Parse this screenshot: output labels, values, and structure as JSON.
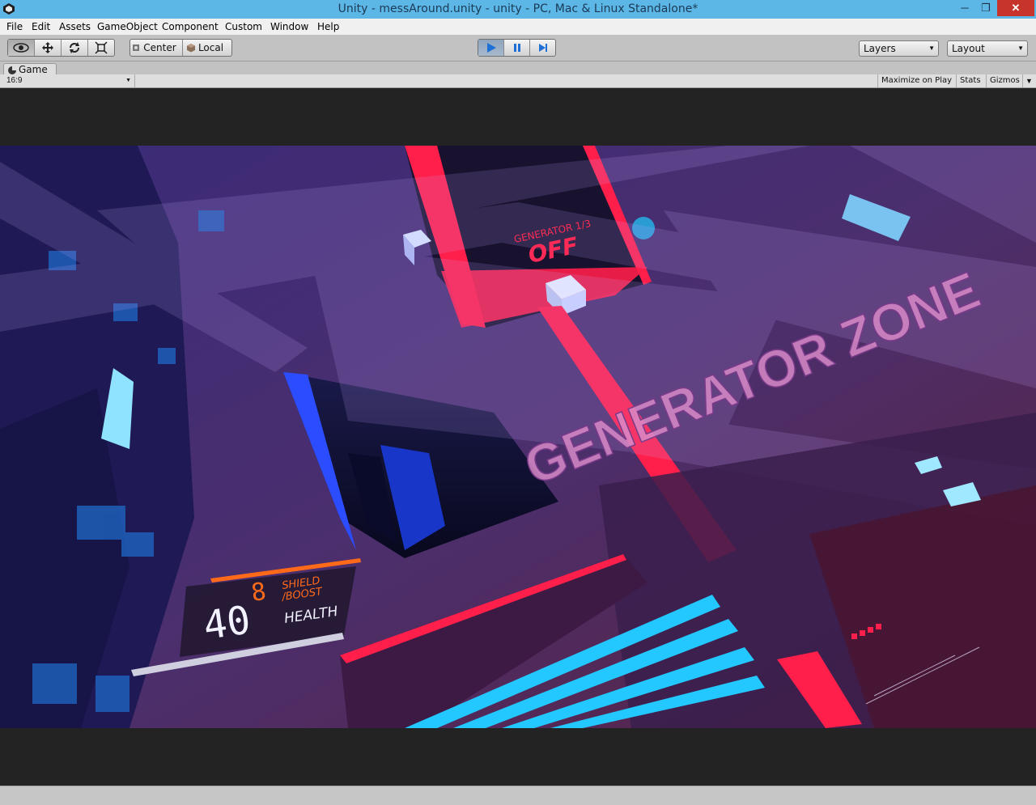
{
  "window": {
    "title": "Unity - messAround.unity - unity - PC, Mac & Linux Standalone*",
    "minimize": "─",
    "maximize": "❐",
    "close": "✕"
  },
  "menu": [
    "File",
    "Edit",
    "Assets",
    "GameObject",
    "Component",
    "Custom",
    "Window",
    "Help"
  ],
  "toolbar": {
    "pivot_label": "Center",
    "space_label": "Local",
    "layers_label": "Layers",
    "layout_label": "Layout",
    "dropdown_arrow": "▼"
  },
  "game_tab": {
    "label": "Game",
    "aspect": "16:9",
    "aspect_arrow": "▼",
    "maximize_on_play": "Maximize on Play",
    "stats": "Stats",
    "gizmos": "Gizmos",
    "menu_glyph": "▼"
  },
  "game": {
    "generator_status": {
      "label": "GENERATOR 1/3",
      "value": "OFF"
    },
    "zone_label": "GENERATOR ZONE",
    "hud": {
      "shield_value": "8",
      "shield_label_1": "SHIELD",
      "shield_label_2": "/BOOST",
      "health_value": "40",
      "health_label": "HEALTH"
    }
  },
  "colors": {
    "accent_red": "#ff1f4a",
    "cyan": "#22c8ff",
    "hud_orange": "#ff6a1a",
    "scene_purple": "#2b1f5c"
  }
}
